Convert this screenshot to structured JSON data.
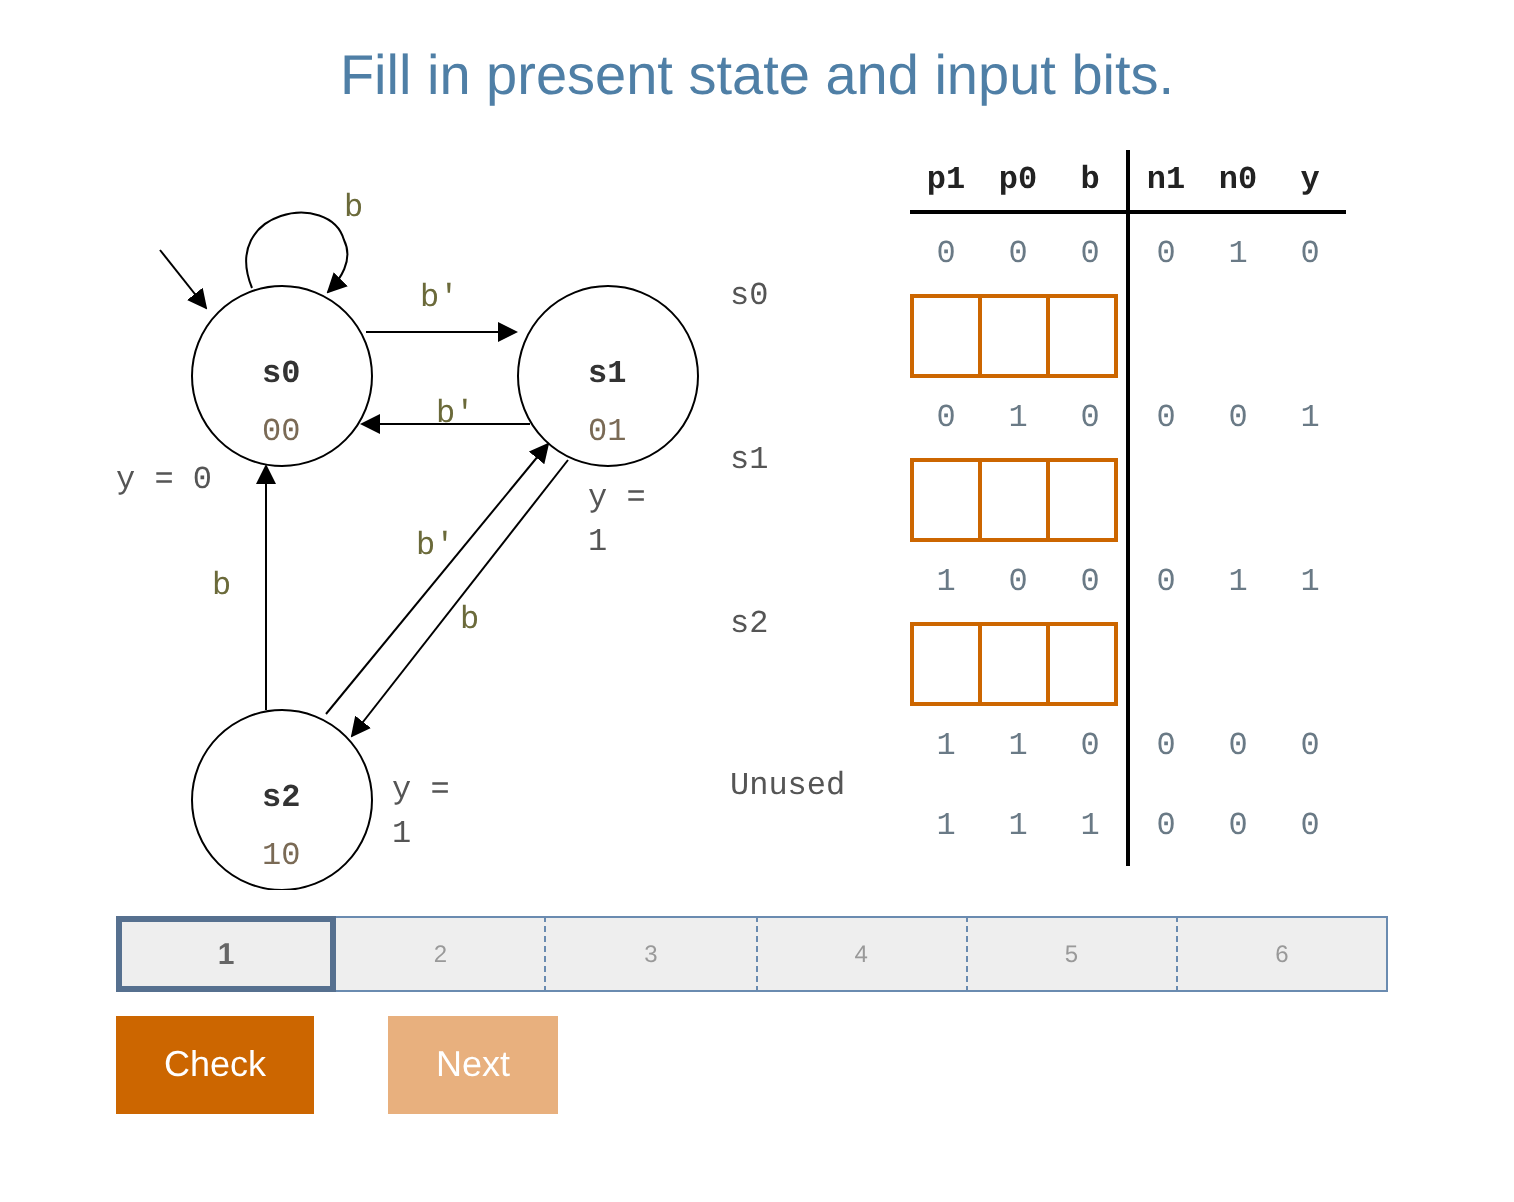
{
  "title": "Fill in present state and input bits.",
  "diagram": {
    "states": [
      {
        "name": "s0",
        "code": "00",
        "output": "y = 0"
      },
      {
        "name": "s1",
        "code": "01",
        "output": "y = 1"
      },
      {
        "name": "s2",
        "code": "10",
        "output": "y = 1"
      }
    ],
    "transitions": [
      {
        "label": "b"
      },
      {
        "label": "b'"
      },
      {
        "label": "b'"
      },
      {
        "label": "b"
      },
      {
        "label": "b'"
      },
      {
        "label": "b"
      }
    ]
  },
  "table": {
    "present_columns": [
      "p1",
      "p0",
      "b"
    ],
    "next_columns": [
      "n1",
      "n0",
      "y"
    ],
    "groups": [
      {
        "label": "s0",
        "rows": [
          {
            "kind": "values",
            "cells": [
              "0",
              "0",
              "0",
              "0",
              "1",
              "0"
            ]
          },
          {
            "kind": "input"
          }
        ]
      },
      {
        "label": "s1",
        "rows": [
          {
            "kind": "values",
            "cells": [
              "0",
              "1",
              "0",
              "0",
              "0",
              "1"
            ]
          },
          {
            "kind": "input"
          }
        ]
      },
      {
        "label": "s2",
        "rows": [
          {
            "kind": "values",
            "cells": [
              "1",
              "0",
              "0",
              "0",
              "1",
              "1"
            ]
          },
          {
            "kind": "input"
          }
        ]
      },
      {
        "label": "Unused",
        "rows": [
          {
            "kind": "values",
            "cells": [
              "1",
              "1",
              "0",
              "0",
              "0",
              "0"
            ]
          },
          {
            "kind": "values",
            "cells": [
              "1",
              "1",
              "1",
              "0",
              "0",
              "0"
            ]
          }
        ]
      }
    ]
  },
  "progress": [
    {
      "label": "1",
      "selected": true
    },
    {
      "label": "2",
      "selected": false
    },
    {
      "label": "3",
      "selected": false
    },
    {
      "label": "4",
      "selected": false
    },
    {
      "label": "5",
      "selected": false
    },
    {
      "label": "6",
      "selected": false
    }
  ],
  "buttons": [
    {
      "label": "Check",
      "disabled": false
    },
    {
      "label": "Next",
      "disabled": true
    }
  ]
}
